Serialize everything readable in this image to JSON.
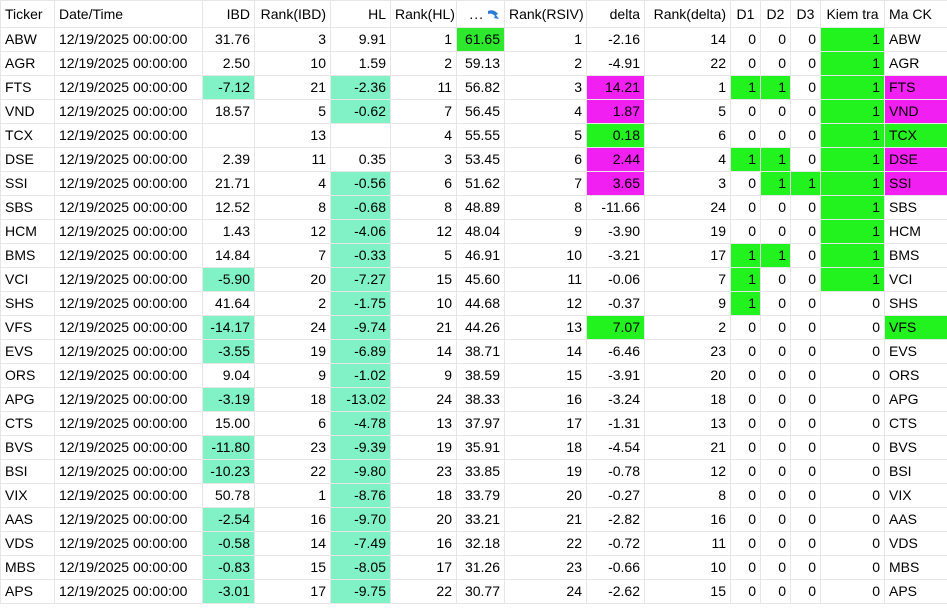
{
  "colors": {
    "aqua": "#80f2c6",
    "green": "#22f31f",
    "magenta": "#f21ff2"
  },
  "headers": [
    "Ticker",
    "Date/Time",
    "IBD",
    "Rank(IBD)",
    "HL",
    "Rank(HL)",
    "...",
    "Rank(RSIV)",
    "delta",
    "Rank(delta)",
    "D1",
    "D2",
    "D3",
    "Kiem tra",
    "Ma CK"
  ],
  "header_sort_icon": "sort-arrow-icon",
  "rows": [
    {
      "ticker": "ABW",
      "dt": "12/19/2025 00:00:00",
      "ibd": "31.76",
      "rank_ibd": "3",
      "hl": "9.91",
      "rank_hl": "1",
      "rsiv": "61.65",
      "rank_rsiv": "1",
      "delta": "-2.16",
      "rank_delta": "14",
      "d1": "0",
      "d2": "0",
      "d3": "0",
      "kiem": "1",
      "ma": "ABW",
      "ibd_c": "",
      "hl_c": "",
      "rsiv_c": "green",
      "delta_c": "",
      "d1_c": "",
      "d2_c": "",
      "d3_c": "",
      "kiem_c": "green",
      "ma_c": ""
    },
    {
      "ticker": "AGR",
      "dt": "12/19/2025 00:00:00",
      "ibd": "2.50",
      "rank_ibd": "10",
      "hl": "1.59",
      "rank_hl": "2",
      "rsiv": "59.13",
      "rank_rsiv": "2",
      "delta": "-4.91",
      "rank_delta": "22",
      "d1": "0",
      "d2": "0",
      "d3": "0",
      "kiem": "1",
      "ma": "AGR",
      "ibd_c": "",
      "hl_c": "",
      "rsiv_c": "",
      "delta_c": "",
      "d1_c": "",
      "d2_c": "",
      "d3_c": "",
      "kiem_c": "green",
      "ma_c": ""
    },
    {
      "ticker": "FTS",
      "dt": "12/19/2025 00:00:00",
      "ibd": "-7.12",
      "rank_ibd": "21",
      "hl": "-2.36",
      "rank_hl": "11",
      "rsiv": "56.82",
      "rank_rsiv": "3",
      "delta": "14.21",
      "rank_delta": "1",
      "d1": "1",
      "d2": "1",
      "d3": "0",
      "kiem": "1",
      "ma": "FTS",
      "ibd_c": "aqua",
      "hl_c": "aqua",
      "rsiv_c": "",
      "delta_c": "magenta",
      "d1_c": "green",
      "d2_c": "green",
      "d3_c": "",
      "kiem_c": "green",
      "ma_c": "magenta"
    },
    {
      "ticker": "VND",
      "dt": "12/19/2025 00:00:00",
      "ibd": "18.57",
      "rank_ibd": "5",
      "hl": "-0.62",
      "rank_hl": "7",
      "rsiv": "56.45",
      "rank_rsiv": "4",
      "delta": "1.87",
      "rank_delta": "5",
      "d1": "0",
      "d2": "0",
      "d3": "0",
      "kiem": "1",
      "ma": "VND",
      "ibd_c": "",
      "hl_c": "aqua",
      "rsiv_c": "",
      "delta_c": "magenta",
      "d1_c": "",
      "d2_c": "",
      "d3_c": "",
      "kiem_c": "green",
      "ma_c": "magenta"
    },
    {
      "ticker": "TCX",
      "dt": "12/19/2025 00:00:00",
      "ibd": "",
      "rank_ibd": "13",
      "hl": "",
      "rank_hl": "4",
      "rsiv": "55.55",
      "rank_rsiv": "5",
      "delta": "0.18",
      "rank_delta": "6",
      "d1": "0",
      "d2": "0",
      "d3": "0",
      "kiem": "1",
      "ma": "TCX",
      "ibd_c": "",
      "hl_c": "",
      "rsiv_c": "",
      "delta_c": "green",
      "d1_c": "",
      "d2_c": "",
      "d3_c": "",
      "kiem_c": "green",
      "ma_c": "green"
    },
    {
      "ticker": "DSE",
      "dt": "12/19/2025 00:00:00",
      "ibd": "2.39",
      "rank_ibd": "11",
      "hl": "0.35",
      "rank_hl": "3",
      "rsiv": "53.45",
      "rank_rsiv": "6",
      "delta": "2.44",
      "rank_delta": "4",
      "d1": "1",
      "d2": "1",
      "d3": "0",
      "kiem": "1",
      "ma": "DSE",
      "ibd_c": "",
      "hl_c": "",
      "rsiv_c": "",
      "delta_c": "magenta",
      "d1_c": "green",
      "d2_c": "green",
      "d3_c": "",
      "kiem_c": "green",
      "ma_c": "magenta"
    },
    {
      "ticker": "SSI",
      "dt": "12/19/2025 00:00:00",
      "ibd": "21.71",
      "rank_ibd": "4",
      "hl": "-0.56",
      "rank_hl": "6",
      "rsiv": "51.62",
      "rank_rsiv": "7",
      "delta": "3.65",
      "rank_delta": "3",
      "d1": "0",
      "d2": "1",
      "d3": "1",
      "kiem": "1",
      "ma": "SSI",
      "ibd_c": "",
      "hl_c": "aqua",
      "rsiv_c": "",
      "delta_c": "magenta",
      "d1_c": "",
      "d2_c": "green",
      "d3_c": "green",
      "kiem_c": "green",
      "ma_c": "magenta"
    },
    {
      "ticker": "SBS",
      "dt": "12/19/2025 00:00:00",
      "ibd": "12.52",
      "rank_ibd": "8",
      "hl": "-0.68",
      "rank_hl": "8",
      "rsiv": "48.89",
      "rank_rsiv": "8",
      "delta": "-11.66",
      "rank_delta": "24",
      "d1": "0",
      "d2": "0",
      "d3": "0",
      "kiem": "1",
      "ma": "SBS",
      "ibd_c": "",
      "hl_c": "aqua",
      "rsiv_c": "",
      "delta_c": "",
      "d1_c": "",
      "d2_c": "",
      "d3_c": "",
      "kiem_c": "green",
      "ma_c": ""
    },
    {
      "ticker": "HCM",
      "dt": "12/19/2025 00:00:00",
      "ibd": "1.43",
      "rank_ibd": "12",
      "hl": "-4.06",
      "rank_hl": "12",
      "rsiv": "48.04",
      "rank_rsiv": "9",
      "delta": "-3.90",
      "rank_delta": "19",
      "d1": "0",
      "d2": "0",
      "d3": "0",
      "kiem": "1",
      "ma": "HCM",
      "ibd_c": "",
      "hl_c": "aqua",
      "rsiv_c": "",
      "delta_c": "",
      "d1_c": "",
      "d2_c": "",
      "d3_c": "",
      "kiem_c": "green",
      "ma_c": ""
    },
    {
      "ticker": "BMS",
      "dt": "12/19/2025 00:00:00",
      "ibd": "14.84",
      "rank_ibd": "7",
      "hl": "-0.33",
      "rank_hl": "5",
      "rsiv": "46.91",
      "rank_rsiv": "10",
      "delta": "-3.21",
      "rank_delta": "17",
      "d1": "1",
      "d2": "1",
      "d3": "0",
      "kiem": "1",
      "ma": "BMS",
      "ibd_c": "",
      "hl_c": "aqua",
      "rsiv_c": "",
      "delta_c": "",
      "d1_c": "green",
      "d2_c": "green",
      "d3_c": "",
      "kiem_c": "green",
      "ma_c": ""
    },
    {
      "ticker": "VCI",
      "dt": "12/19/2025 00:00:00",
      "ibd": "-5.90",
      "rank_ibd": "20",
      "hl": "-7.27",
      "rank_hl": "15",
      "rsiv": "45.60",
      "rank_rsiv": "11",
      "delta": "-0.06",
      "rank_delta": "7",
      "d1": "1",
      "d2": "0",
      "d3": "0",
      "kiem": "1",
      "ma": "VCI",
      "ibd_c": "aqua",
      "hl_c": "aqua",
      "rsiv_c": "",
      "delta_c": "",
      "d1_c": "green",
      "d2_c": "",
      "d3_c": "",
      "kiem_c": "green",
      "ma_c": ""
    },
    {
      "ticker": "SHS",
      "dt": "12/19/2025 00:00:00",
      "ibd": "41.64",
      "rank_ibd": "2",
      "hl": "-1.75",
      "rank_hl": "10",
      "rsiv": "44.68",
      "rank_rsiv": "12",
      "delta": "-0.37",
      "rank_delta": "9",
      "d1": "1",
      "d2": "0",
      "d3": "0",
      "kiem": "0",
      "ma": "SHS",
      "ibd_c": "",
      "hl_c": "aqua",
      "rsiv_c": "",
      "delta_c": "",
      "d1_c": "green",
      "d2_c": "",
      "d3_c": "",
      "kiem_c": "",
      "ma_c": ""
    },
    {
      "ticker": "VFS",
      "dt": "12/19/2025 00:00:00",
      "ibd": "-14.17",
      "rank_ibd": "24",
      "hl": "-9.74",
      "rank_hl": "21",
      "rsiv": "44.26",
      "rank_rsiv": "13",
      "delta": "7.07",
      "rank_delta": "2",
      "d1": "0",
      "d2": "0",
      "d3": "0",
      "kiem": "0",
      "ma": "VFS",
      "ibd_c": "aqua",
      "hl_c": "aqua",
      "rsiv_c": "",
      "delta_c": "green",
      "d1_c": "",
      "d2_c": "",
      "d3_c": "",
      "kiem_c": "",
      "ma_c": "green"
    },
    {
      "ticker": "EVS",
      "dt": "12/19/2025 00:00:00",
      "ibd": "-3.55",
      "rank_ibd": "19",
      "hl": "-6.89",
      "rank_hl": "14",
      "rsiv": "38.71",
      "rank_rsiv": "14",
      "delta": "-6.46",
      "rank_delta": "23",
      "d1": "0",
      "d2": "0",
      "d3": "0",
      "kiem": "0",
      "ma": "EVS",
      "ibd_c": "aqua",
      "hl_c": "aqua",
      "rsiv_c": "",
      "delta_c": "",
      "d1_c": "",
      "d2_c": "",
      "d3_c": "",
      "kiem_c": "",
      "ma_c": ""
    },
    {
      "ticker": "ORS",
      "dt": "12/19/2025 00:00:00",
      "ibd": "9.04",
      "rank_ibd": "9",
      "hl": "-1.02",
      "rank_hl": "9",
      "rsiv": "38.59",
      "rank_rsiv": "15",
      "delta": "-3.91",
      "rank_delta": "20",
      "d1": "0",
      "d2": "0",
      "d3": "0",
      "kiem": "0",
      "ma": "ORS",
      "ibd_c": "",
      "hl_c": "aqua",
      "rsiv_c": "",
      "delta_c": "",
      "d1_c": "",
      "d2_c": "",
      "d3_c": "",
      "kiem_c": "",
      "ma_c": ""
    },
    {
      "ticker": "APG",
      "dt": "12/19/2025 00:00:00",
      "ibd": "-3.19",
      "rank_ibd": "18",
      "hl": "-13.02",
      "rank_hl": "24",
      "rsiv": "38.33",
      "rank_rsiv": "16",
      "delta": "-3.24",
      "rank_delta": "18",
      "d1": "0",
      "d2": "0",
      "d3": "0",
      "kiem": "0",
      "ma": "APG",
      "ibd_c": "aqua",
      "hl_c": "aqua",
      "rsiv_c": "",
      "delta_c": "",
      "d1_c": "",
      "d2_c": "",
      "d3_c": "",
      "kiem_c": "",
      "ma_c": ""
    },
    {
      "ticker": "CTS",
      "dt": "12/19/2025 00:00:00",
      "ibd": "15.00",
      "rank_ibd": "6",
      "hl": "-4.78",
      "rank_hl": "13",
      "rsiv": "37.97",
      "rank_rsiv": "17",
      "delta": "-1.31",
      "rank_delta": "13",
      "d1": "0",
      "d2": "0",
      "d3": "0",
      "kiem": "0",
      "ma": "CTS",
      "ibd_c": "",
      "hl_c": "aqua",
      "rsiv_c": "",
      "delta_c": "",
      "d1_c": "",
      "d2_c": "",
      "d3_c": "",
      "kiem_c": "",
      "ma_c": ""
    },
    {
      "ticker": "BVS",
      "dt": "12/19/2025 00:00:00",
      "ibd": "-11.80",
      "rank_ibd": "23",
      "hl": "-9.39",
      "rank_hl": "19",
      "rsiv": "35.91",
      "rank_rsiv": "18",
      "delta": "-4.54",
      "rank_delta": "21",
      "d1": "0",
      "d2": "0",
      "d3": "0",
      "kiem": "0",
      "ma": "BVS",
      "ibd_c": "aqua",
      "hl_c": "aqua",
      "rsiv_c": "",
      "delta_c": "",
      "d1_c": "",
      "d2_c": "",
      "d3_c": "",
      "kiem_c": "",
      "ma_c": ""
    },
    {
      "ticker": "BSI",
      "dt": "12/19/2025 00:00:00",
      "ibd": "-10.23",
      "rank_ibd": "22",
      "hl": "-9.80",
      "rank_hl": "23",
      "rsiv": "33.85",
      "rank_rsiv": "19",
      "delta": "-0.78",
      "rank_delta": "12",
      "d1": "0",
      "d2": "0",
      "d3": "0",
      "kiem": "0",
      "ma": "BSI",
      "ibd_c": "aqua",
      "hl_c": "aqua",
      "rsiv_c": "",
      "delta_c": "",
      "d1_c": "",
      "d2_c": "",
      "d3_c": "",
      "kiem_c": "",
      "ma_c": ""
    },
    {
      "ticker": "VIX",
      "dt": "12/19/2025 00:00:00",
      "ibd": "50.78",
      "rank_ibd": "1",
      "hl": "-8.76",
      "rank_hl": "18",
      "rsiv": "33.79",
      "rank_rsiv": "20",
      "delta": "-0.27",
      "rank_delta": "8",
      "d1": "0",
      "d2": "0",
      "d3": "0",
      "kiem": "0",
      "ma": "VIX",
      "ibd_c": "",
      "hl_c": "aqua",
      "rsiv_c": "",
      "delta_c": "",
      "d1_c": "",
      "d2_c": "",
      "d3_c": "",
      "kiem_c": "",
      "ma_c": ""
    },
    {
      "ticker": "AAS",
      "dt": "12/19/2025 00:00:00",
      "ibd": "-2.54",
      "rank_ibd": "16",
      "hl": "-9.70",
      "rank_hl": "20",
      "rsiv": "33.21",
      "rank_rsiv": "21",
      "delta": "-2.82",
      "rank_delta": "16",
      "d1": "0",
      "d2": "0",
      "d3": "0",
      "kiem": "0",
      "ma": "AAS",
      "ibd_c": "aqua",
      "hl_c": "aqua",
      "rsiv_c": "",
      "delta_c": "",
      "d1_c": "",
      "d2_c": "",
      "d3_c": "",
      "kiem_c": "",
      "ma_c": ""
    },
    {
      "ticker": "VDS",
      "dt": "12/19/2025 00:00:00",
      "ibd": "-0.58",
      "rank_ibd": "14",
      "hl": "-7.49",
      "rank_hl": "16",
      "rsiv": "32.18",
      "rank_rsiv": "22",
      "delta": "-0.72",
      "rank_delta": "11",
      "d1": "0",
      "d2": "0",
      "d3": "0",
      "kiem": "0",
      "ma": "VDS",
      "ibd_c": "aqua",
      "hl_c": "aqua",
      "rsiv_c": "",
      "delta_c": "",
      "d1_c": "",
      "d2_c": "",
      "d3_c": "",
      "kiem_c": "",
      "ma_c": ""
    },
    {
      "ticker": "MBS",
      "dt": "12/19/2025 00:00:00",
      "ibd": "-0.83",
      "rank_ibd": "15",
      "hl": "-8.05",
      "rank_hl": "17",
      "rsiv": "31.26",
      "rank_rsiv": "23",
      "delta": "-0.66",
      "rank_delta": "10",
      "d1": "0",
      "d2": "0",
      "d3": "0",
      "kiem": "0",
      "ma": "MBS",
      "ibd_c": "aqua",
      "hl_c": "aqua",
      "rsiv_c": "",
      "delta_c": "",
      "d1_c": "",
      "d2_c": "",
      "d3_c": "",
      "kiem_c": "",
      "ma_c": ""
    },
    {
      "ticker": "APS",
      "dt": "12/19/2025 00:00:00",
      "ibd": "-3.01",
      "rank_ibd": "17",
      "hl": "-9.75",
      "rank_hl": "22",
      "rsiv": "30.77",
      "rank_rsiv": "24",
      "delta": "-2.62",
      "rank_delta": "15",
      "d1": "0",
      "d2": "0",
      "d3": "0",
      "kiem": "0",
      "ma": "APS",
      "ibd_c": "aqua",
      "hl_c": "aqua",
      "rsiv_c": "",
      "delta_c": "",
      "d1_c": "",
      "d2_c": "",
      "d3_c": "",
      "kiem_c": "",
      "ma_c": ""
    }
  ]
}
